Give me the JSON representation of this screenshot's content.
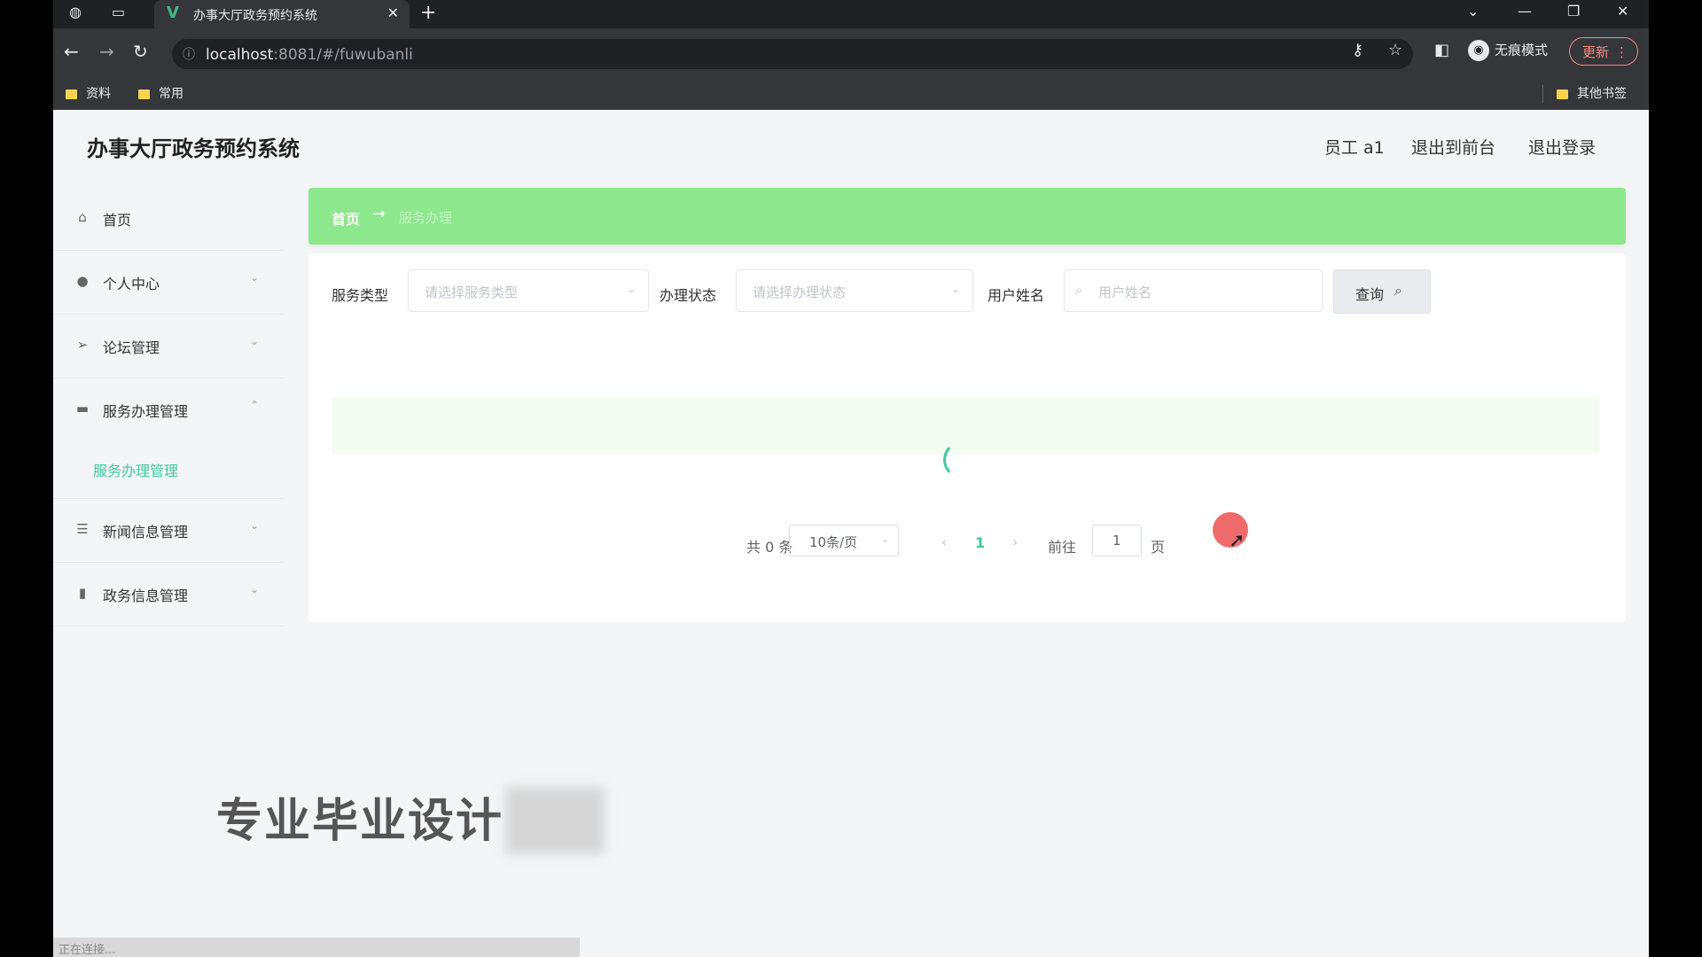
{
  "browser": {
    "tab_title": "办事大厅政务预约系统",
    "tab_close": "✕",
    "new_tab": "+",
    "url_host": "localhost",
    "url_rest": ":8081/#/fuwubanli",
    "incognito_label": "无痕模式",
    "update_label": "更新",
    "bookmarks": [
      "资料",
      "常用"
    ],
    "other_bookmarks": "其他书签"
  },
  "header": {
    "title": "办事大厅政务预约系统",
    "user": "员工 a1",
    "to_frontend": "退出到前台",
    "logout": "退出登录"
  },
  "sidebar": {
    "items": [
      {
        "label": "首页",
        "icon": "home-icon",
        "expanded": null
      },
      {
        "label": "个人中心",
        "icon": "user-icon",
        "expanded": false
      },
      {
        "label": "论坛管理",
        "icon": "send-icon",
        "expanded": false
      },
      {
        "label": "服务办理管理",
        "icon": "chat-icon",
        "expanded": true
      },
      {
        "label": "新闻信息管理",
        "icon": "list-icon",
        "expanded": false
      },
      {
        "label": "政务信息管理",
        "icon": "bar-chart-icon",
        "expanded": false
      }
    ],
    "submenu_active": "服务办理管理"
  },
  "breadcrumb": {
    "home": "首页",
    "arrow": "→",
    "current": "服务办理"
  },
  "filters": {
    "service_type_label": "服务类型",
    "service_type_placeholder": "请选择服务类型",
    "status_label": "办理状态",
    "status_placeholder": "请选择办理状态",
    "username_label": "用户姓名",
    "username_placeholder": "用户姓名",
    "query_label": "查询"
  },
  "pagination": {
    "total": "共 0 条",
    "page_size": "10条/页",
    "current_page": "1",
    "goto_label": "前往",
    "goto_value": "1",
    "page_unit": "页"
  },
  "overlay": {
    "watermark": "专业毕业设计",
    "status_text": "正在连接..."
  },
  "colors": {
    "accent": "#40c9a2",
    "breadcrumb_bg": "#8de88d",
    "cursor_highlight": "#ef6a6a"
  }
}
